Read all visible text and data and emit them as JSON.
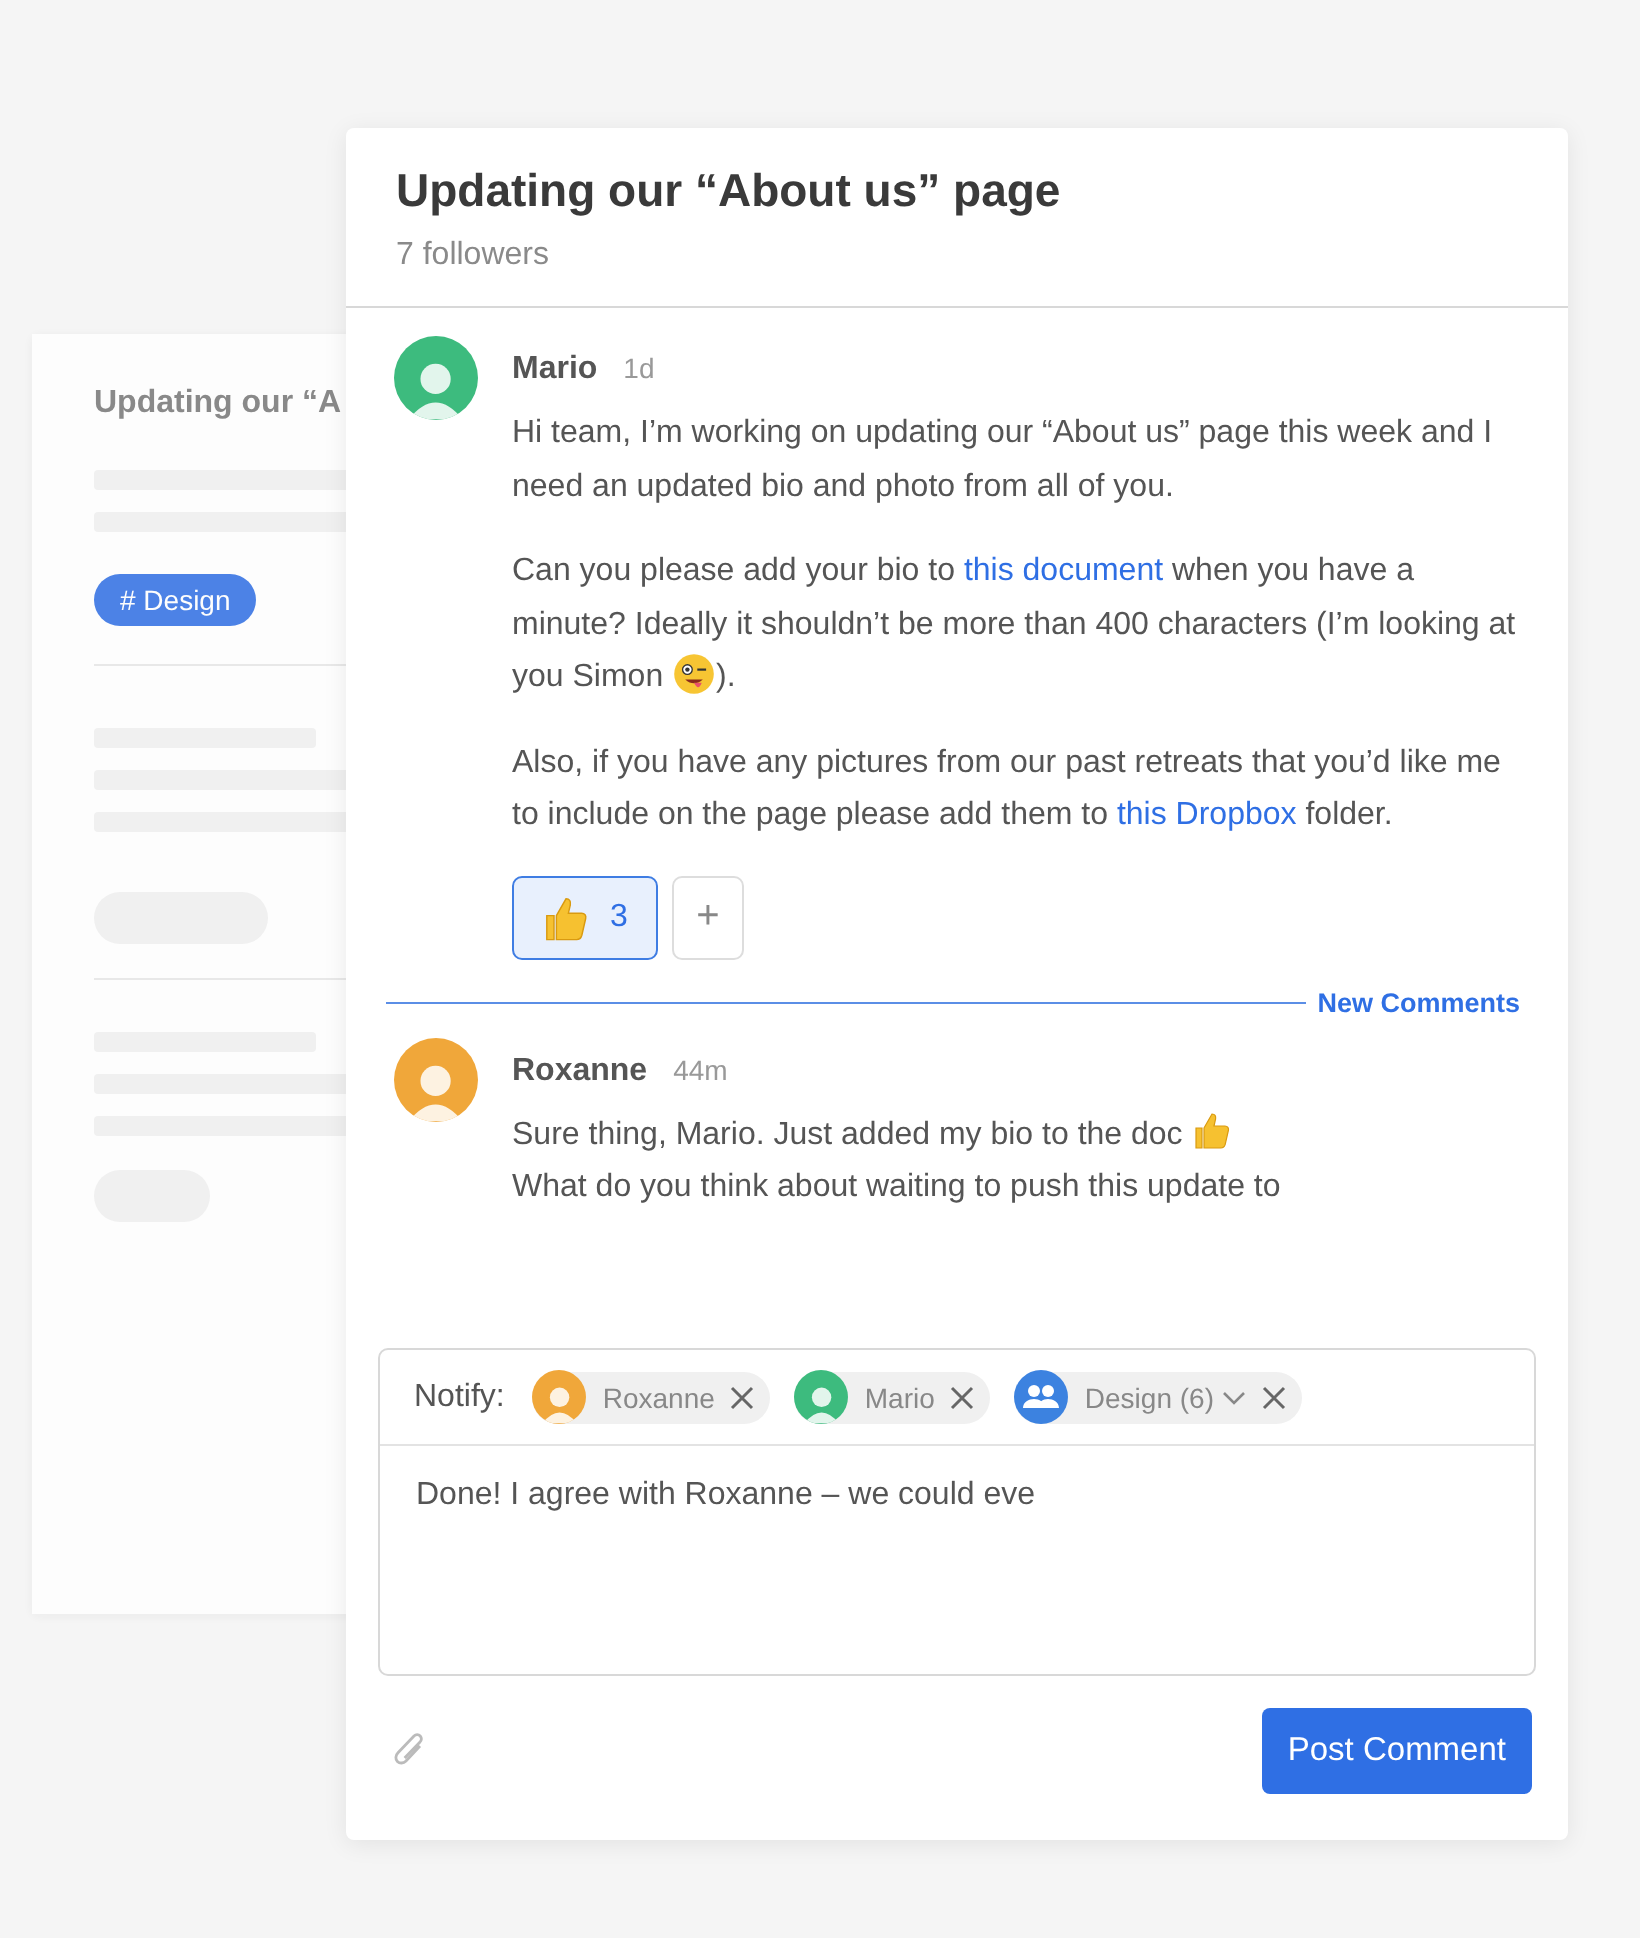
{
  "back_card": {
    "title": "Updating our “A",
    "tag": "# Design"
  },
  "thread": {
    "title": "Updating our “About us” page",
    "followers": "7 followers"
  },
  "comments": [
    {
      "author": "Mario",
      "time": "1d",
      "color": "#3dbb7e",
      "paragraphs": [
        [
          {
            "kind": "text",
            "text": "Hi team, I’m working on updating our “About us” page this week and I need an updated bio and photo from all of you."
          }
        ],
        [
          {
            "kind": "text",
            "text": "Can you please add your bio to "
          },
          {
            "kind": "link",
            "text": "this document"
          },
          {
            "kind": "text",
            "text": " when you have a minute? Ideally it shouldn’t be more than 400 characters (I’m looking at you Simon "
          },
          {
            "kind": "wink"
          },
          {
            "kind": "text",
            "text": ")."
          }
        ],
        [
          {
            "kind": "text",
            "text": "Also, if you have any pictures from our past retreats that you’d like me to include on the page please add them to "
          },
          {
            "kind": "link",
            "text": "this Dropbox"
          },
          {
            "kind": "text",
            "text": " folder."
          }
        ]
      ],
      "reactions": [
        {
          "kind": "thumbs",
          "count": "3",
          "selected": true
        }
      ],
      "add_reaction": "+"
    },
    {
      "author": "Roxanne",
      "time": "44m",
      "color": "#f0a73a",
      "paragraphs": [
        [
          {
            "kind": "text",
            "text": "Sure thing, Mario. Just added my bio to the doc "
          },
          {
            "kind": "thumbs"
          }
        ],
        [
          {
            "kind": "text",
            "text": "What do you think about waiting to push this update to"
          }
        ]
      ]
    }
  ],
  "new_comments_label": "New Comments",
  "composer": {
    "notify_label": "Notify:",
    "chips": [
      {
        "kind": "person",
        "label": "Roxanne",
        "color": "#f0a73a"
      },
      {
        "kind": "person",
        "label": "Mario",
        "color": "#3dbb7e"
      },
      {
        "kind": "group",
        "label": "Design (6)",
        "color": "#3c82e0"
      }
    ],
    "value": "Done! I agree with Roxanne – we could eve",
    "submit": "Post Comment"
  }
}
